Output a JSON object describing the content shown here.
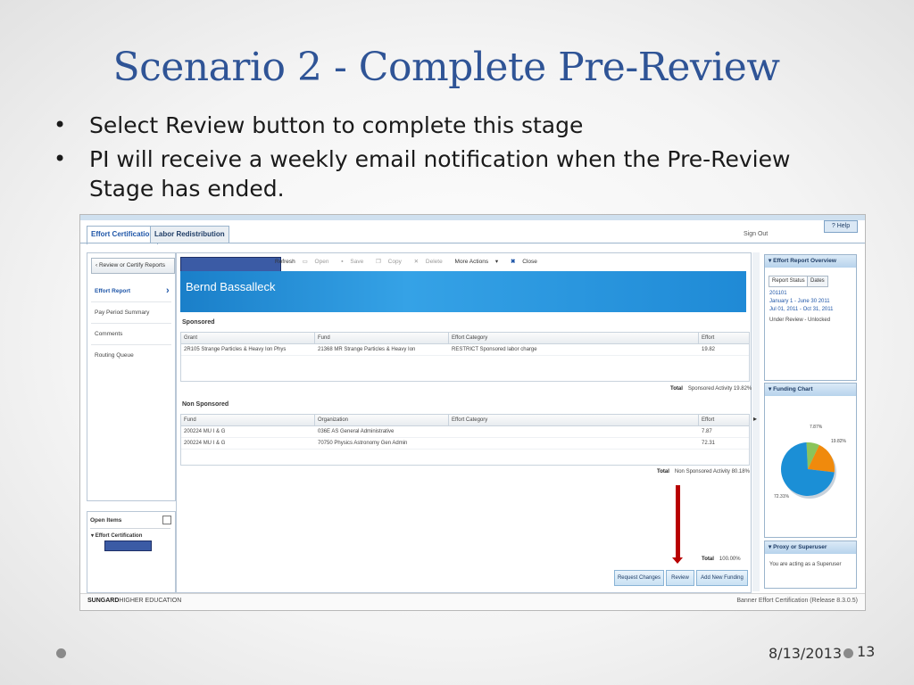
{
  "slide": {
    "title": "Scenario 2 - Complete Pre-Review",
    "bullets": [
      "Select Review button to complete this stage",
      "PI will receive a weekly email notification when the Pre-Review Stage has ended."
    ],
    "date": "8/13/2013",
    "page_number": "13"
  },
  "app": {
    "tabs": [
      "Effort Certification",
      "Labor Redistribution"
    ],
    "help_label": "? Help",
    "signout_label": "Sign Out",
    "back_button": "Review or Certify Reports",
    "nav_items": [
      "Effort Report",
      "Pay Period Summary",
      "Comments",
      "Routing Queue"
    ],
    "open_items": {
      "title": "Open Items",
      "group": "Effort Certification"
    },
    "toolbar": [
      "Refresh",
      "Open",
      "Save",
      "Copy",
      "Delete",
      "More Actions",
      "Close"
    ],
    "employee_name": "Bernd Bassalleck",
    "sponsored": {
      "title": "Sponsored",
      "headers": [
        "Grant",
        "Fund",
        "Effort Category",
        "Effort"
      ],
      "rows": [
        [
          "2R105 Strange Particles & Heavy Ion Phys",
          "21368 MR Strange Particles & Heavy Ion",
          "RESTRICT Sponsored labor charge",
          "19.82"
        ]
      ],
      "total_label": "Total",
      "total_value": "Sponsored Activity 19.82%"
    },
    "non_sponsored": {
      "title": "Non Sponsored",
      "headers": [
        "Fund",
        "Organization",
        "Effort Category",
        "Effort"
      ],
      "rows": [
        [
          "200224 MU I & G",
          "036E AS General Administrative",
          "",
          "7.87"
        ],
        [
          "200224 MU I & G",
          "70750 Physics Astronomy Gen Admin",
          "",
          "72.31"
        ]
      ],
      "total_label": "Total",
      "total_value": "Non Sponsored Activity 80.18%"
    },
    "grand_total_label": "Total",
    "grand_total_value": "100.00%",
    "buttons": [
      "Request Changes",
      "Review",
      "Add New Funding"
    ],
    "overview": {
      "title": "Effort Report Overview",
      "tabs": [
        "Report Status",
        "Dates"
      ],
      "lines": [
        "201101",
        "January 1 - June 30 2011",
        "Jul 01, 2011 - Oct 31, 2011",
        "Under Review - Unlocked"
      ]
    },
    "funding_chart": {
      "title": "Funding Chart",
      "labels": [
        "7.87%",
        "19.82%",
        "72.31%"
      ]
    },
    "proxy": {
      "title": "Proxy or Superuser",
      "text": "You are acting as a Superuser"
    },
    "footer": {
      "logo_bold": "SUNGARD",
      "logo_rest": "HIGHER EDUCATION",
      "release": "Banner Effort Certification (Release 8.3.0.5)"
    }
  },
  "chart_data": {
    "type": "pie",
    "categories": [
      "7.87%",
      "19.82%",
      "72.31%"
    ],
    "values": [
      7.87,
      19.82,
      72.31
    ],
    "colors": [
      "#8bc45a",
      "#f08a0c",
      "#1b8fd6"
    ]
  }
}
